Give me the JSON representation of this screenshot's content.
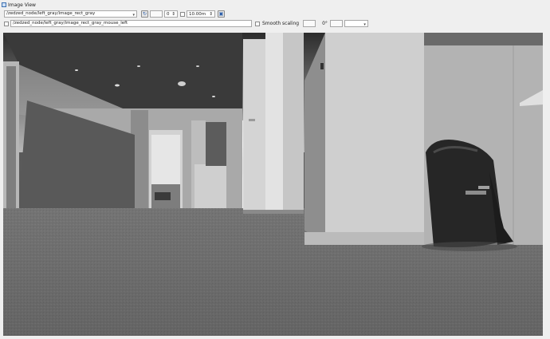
{
  "window": {
    "title": "Image View"
  },
  "toolbar": {
    "topic": "/zedzed_node/left_gray/image_rect_gray",
    "min_value": "0",
    "max_value": "10.00m"
  },
  "mouse_row": {
    "topic_value": "/zedzed_node/left_gray/image_rect_gray_mouse_left",
    "smooth_label": "Smooth scaling",
    "rotation": "0°"
  }
}
